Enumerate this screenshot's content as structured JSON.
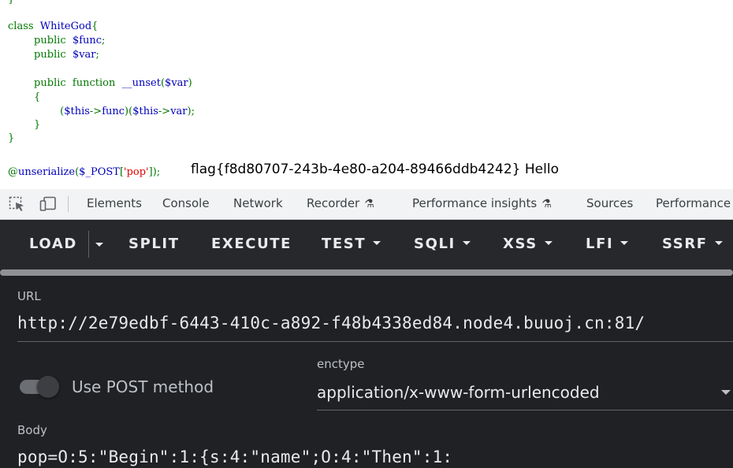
{
  "source": {
    "lines": [
      [
        {
          "t": "}",
          "c": "kw"
        }
      ],
      [],
      [
        {
          "t": "class  ",
          "c": "kw"
        },
        {
          "t": "WhiteGod",
          "c": "id"
        },
        {
          "t": "{",
          "c": "kw"
        }
      ],
      [
        {
          "t": "        public  ",
          "c": "kw"
        },
        {
          "t": "$func",
          "c": "id"
        },
        {
          "t": ";",
          "c": "kw"
        }
      ],
      [
        {
          "t": "        public  ",
          "c": "kw"
        },
        {
          "t": "$var",
          "c": "id"
        },
        {
          "t": ";",
          "c": "kw"
        }
      ],
      [],
      [
        {
          "t": "        public  function  ",
          "c": "kw"
        },
        {
          "t": "__unset",
          "c": "id"
        },
        {
          "t": "(",
          "c": "kw"
        },
        {
          "t": "$var",
          "c": "id"
        },
        {
          "t": ")",
          "c": "kw"
        }
      ],
      [
        {
          "t": "        {",
          "c": "kw"
        }
      ],
      [
        {
          "t": "                (",
          "c": "kw"
        },
        {
          "t": "$this",
          "c": "id"
        },
        {
          "t": "->",
          "c": "kw"
        },
        {
          "t": "func",
          "c": "id"
        },
        {
          "t": ")(",
          "c": "kw"
        },
        {
          "t": "$this",
          "c": "id"
        },
        {
          "t": "->",
          "c": "kw"
        },
        {
          "t": "var",
          "c": "id"
        },
        {
          "t": ");",
          "c": "kw"
        }
      ],
      [
        {
          "t": "        }",
          "c": "kw"
        }
      ],
      [
        {
          "t": "}",
          "c": "kw"
        }
      ],
      [],
      [
        {
          "t": "@",
          "c": "kw"
        },
        {
          "t": "unserialize",
          "c": "id"
        },
        {
          "t": "(",
          "c": "kw"
        },
        {
          "t": "$_POST",
          "c": "id"
        },
        {
          "t": "[",
          "c": "kw"
        },
        {
          "t": "'pop'",
          "c": "st"
        },
        {
          "t": "]);",
          "c": "kw"
        }
      ]
    ],
    "output": "flag{f8d80707-243b-4e80-a204-89466ddb4242} Hello"
  },
  "devtools": {
    "inspect_icon": "element-picker-icon",
    "device_icon": "device-toolbar-icon",
    "tabs": {
      "elements": "Elements",
      "console": "Console",
      "network": "Network",
      "recorder": "Recorder",
      "performance_insights": "Performance insights",
      "sources": "Sources",
      "performance": "Performance"
    },
    "experimental_icon": "flask-icon"
  },
  "hackbar": {
    "buttons": {
      "load": "LOAD",
      "split": "SPLIT",
      "execute": "EXECUTE",
      "test": "TEST",
      "sqli": "SQLI",
      "xss": "XSS",
      "lfi": "LFI",
      "ssrf": "SSRF"
    },
    "url_label": "URL",
    "url_value": "http://2e79edbf-6443-410c-a892-f48b4338ed84.node4.buuoj.cn:81/",
    "post_toggle_label": "Use POST method",
    "post_enabled": false,
    "enctype_label": "enctype",
    "enctype_value": "application/x-www-form-urlencoded",
    "body_label": "Body",
    "body_value": "pop=O:5:\"Begin\":1:{s:4:\"name\";O:4:\"Then\":1:"
  },
  "colors": {
    "php_keyword": "#007700",
    "php_identifier": "#0000bb",
    "php_string": "#dd0000",
    "hackbar_bg": "#202124"
  }
}
